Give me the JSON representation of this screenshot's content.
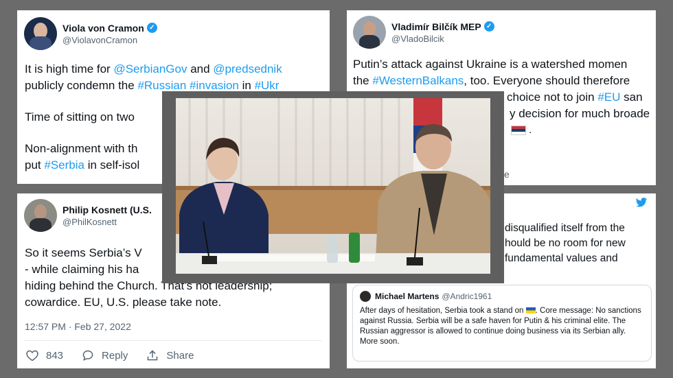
{
  "tweet_viola": {
    "name": "Viola von Cramon",
    "handle": "@ViolavonCramon",
    "line1": [
      "It is high time for ",
      "@SerbianGov",
      " and ",
      "@predsednik"
    ],
    "line2": [
      "publicly condemn the ",
      "#Russian",
      " ",
      "#invasion",
      " in ",
      "#Ukr"
    ],
    "line3": "Time of sitting on two",
    "line4": "Non-alignment with th",
    "line5": [
      "put ",
      "#Serbia",
      " in self-isol"
    ]
  },
  "tweet_bilcik": {
    "name": "Vladimír Bilčík MEP",
    "handle": "@VladoBilcik",
    "line1": "Putin’s attack against Ukraine is a watershed momen",
    "line2": [
      "the ",
      "#WesternBalkans",
      ", too. Everyone should therefore"
    ],
    "line3": [
      "choice not to join ",
      "#EU",
      " san"
    ],
    "line4": "y decision for much broade",
    "tail": "e"
  },
  "tweet_kosnett": {
    "name": "Philip Kosnett (U.S.",
    "handle": "@PhilKosnett",
    "line1": "So it seems Serbia’s V",
    "line2": "- while claiming his ha",
    "line3": "hiding behind the Church. That’s not leadership;",
    "line4": "cowardice.  EU, U.S. please take note.",
    "timestamp": "12:57 PM · Feb 27, 2022",
    "likes": "843",
    "reply_label": "Reply",
    "share_label": "Share"
  },
  "tweet_martens_qt": {
    "line1": "disqualified itself from the",
    "line2": "hould be no room for new",
    "line3": "fundamental values and",
    "quote_name": "Michael Martens",
    "quote_handle": "@Andric1961",
    "quote_text_a": "After days of hesitation, Serbia took a stand on",
    "quote_text_b": ". Core message: No sanctions against Russia. Serbia will be a safe haven for Putin & his criminal elite. The Russian aggressor is allowed to continue doing business via its Serbian ally. More soon."
  },
  "colors": {
    "link": "#1d9bf0",
    "muted": "#536471",
    "background": "#6b6b6b"
  },
  "icons": [
    "verified-badge-icon",
    "heart-icon",
    "reply-icon",
    "share-icon",
    "twitter-bird-icon",
    "ukraine-flag-icon",
    "serbia-flag-icon"
  ]
}
